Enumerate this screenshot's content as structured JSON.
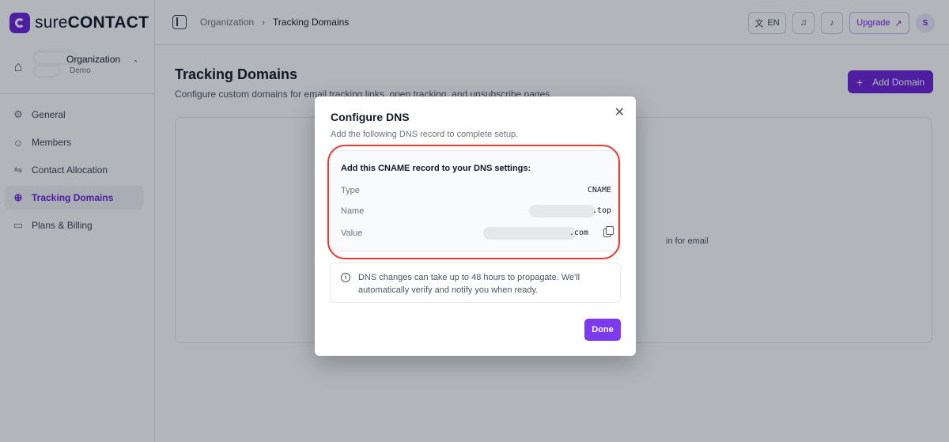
{
  "brand": {
    "name_light": "sure",
    "name_bold": "CONTACT"
  },
  "org": {
    "name": "Organization",
    "sub": "Demo"
  },
  "sidebar": {
    "items": [
      {
        "label": "General",
        "icon": "gear-icon"
      },
      {
        "label": "Members",
        "icon": "users-icon"
      },
      {
        "label": "Contact Allocation",
        "icon": "allocation-icon"
      },
      {
        "label": "Tracking Domains",
        "icon": "globe-icon",
        "active": true
      },
      {
        "label": "Plans & Billing",
        "icon": "card-icon"
      }
    ]
  },
  "topbar": {
    "breadcrumb": [
      "Organization",
      "Tracking Domains"
    ],
    "lang": "EN",
    "upgrade": "Upgrade",
    "avatar": "S"
  },
  "main": {
    "title": "Tracking Domains",
    "subtitle": "Configure custom domains for email tracking links, open tracking, and unsubscribe pages.",
    "add_button": "Add Domain",
    "card_text_fragment": "in for email"
  },
  "modal": {
    "title": "Configure DNS",
    "subtitle": "Add the following DNS record to complete setup.",
    "record_heading": "Add this CNAME record to your DNS settings:",
    "rows": [
      {
        "label": "Type",
        "value": "CNAME"
      },
      {
        "label": "Name",
        "value": ".top"
      },
      {
        "label": "Value",
        "value": ".com"
      }
    ],
    "notice": "DNS changes can take up to 48 hours to propagate. We'll automatically verify and notify you when ready.",
    "done": "Done"
  },
  "colors": {
    "accent": "#6b21d8",
    "highlight": "#e53935"
  }
}
